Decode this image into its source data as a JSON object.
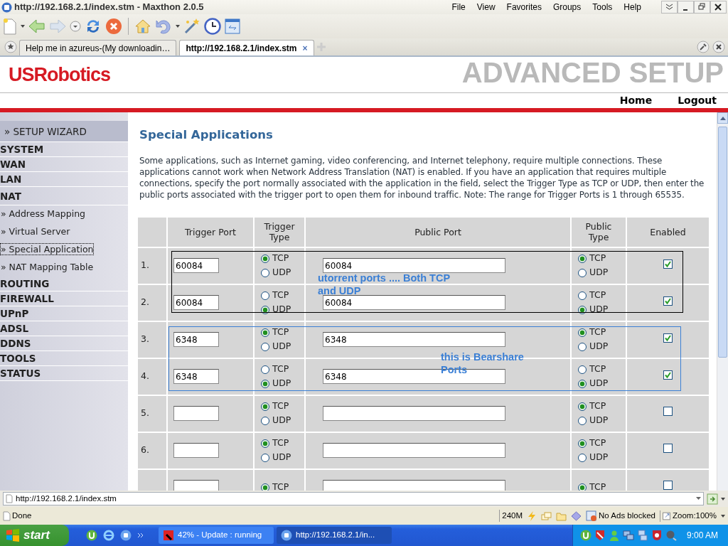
{
  "window": {
    "title": "http://192.168.2.1/index.stm - Maxthon 2.0.5"
  },
  "menu": [
    "File",
    "View",
    "Favorites",
    "Groups",
    "Tools",
    "Help"
  ],
  "tabs": [
    {
      "label": "Help me in azureus-(My downloadin…",
      "selected": false
    },
    {
      "label": "http://192.168.2.1/index.stm",
      "selected": true,
      "close": "×"
    }
  ],
  "router": {
    "logo": "USRobotics",
    "banner": "ADVANCED SETUP",
    "nav": [
      "Home",
      "Logout"
    ]
  },
  "sidebar": {
    "items": [
      {
        "label": "» SETUP WIZARD",
        "kind": "wizard",
        "selected": false
      },
      {
        "label": "SYSTEM",
        "kind": "section",
        "selected": false
      },
      {
        "label": "WAN",
        "kind": "section",
        "selected": false
      },
      {
        "label": "LAN",
        "kind": "section",
        "selected": false
      },
      {
        "label": "NAT",
        "kind": "section",
        "selected": false
      },
      {
        "label": "» Address Mapping",
        "kind": "sub",
        "selected": false
      },
      {
        "label": "» Virtual Server",
        "kind": "sub",
        "selected": false
      },
      {
        "label": "» Special Application",
        "kind": "sub",
        "selected": true
      },
      {
        "label": "» NAT Mapping Table",
        "kind": "sub",
        "selected": false
      },
      {
        "label": "ROUTING",
        "kind": "section",
        "selected": false
      },
      {
        "label": "FIREWALL",
        "kind": "section",
        "selected": false
      },
      {
        "label": "UPnP",
        "kind": "section",
        "selected": false
      },
      {
        "label": "ADSL",
        "kind": "section",
        "selected": false
      },
      {
        "label": "DDNS",
        "kind": "section",
        "selected": false
      },
      {
        "label": "TOOLS",
        "kind": "section",
        "selected": false
      },
      {
        "label": "STATUS",
        "kind": "section",
        "selected": false
      }
    ]
  },
  "content": {
    "title": "Special Applications",
    "intro": "Some applications, such as Internet gaming, video conferencing, and Internet telephony, require multiple connections. These applications cannot work when Network Address Translation (NAT) is enabled. If you have an application that requires multiple connections, specify the port normally associated with the application in the field, select the Trigger Type as TCP or UDP, then enter the public ports associated with the trigger port to open them for inbound traffic. Note: The range for Trigger Ports is 1 through 65535.",
    "columns": [
      "Trigger Port",
      "Trigger Type",
      "Public Port",
      "Public Type",
      "Enabled"
    ],
    "rows": [
      {
        "number": "1.",
        "trigger_port": "60084",
        "trigger_type": [
          {
            "label": "TCP",
            "selected": true
          },
          {
            "label": "UDP",
            "selected": false
          }
        ],
        "public_port": "60084",
        "public_type": [
          {
            "label": "TCP",
            "selected": true
          },
          {
            "label": "UDP",
            "selected": false
          }
        ],
        "enabled": true
      },
      {
        "number": "2.",
        "trigger_port": "60084",
        "trigger_type": [
          {
            "label": "TCP",
            "selected": false
          },
          {
            "label": "UDP",
            "selected": true
          }
        ],
        "public_port": "60084",
        "public_type": [
          {
            "label": "TCP",
            "selected": false
          },
          {
            "label": "UDP",
            "selected": true
          }
        ],
        "enabled": true
      },
      {
        "number": "3.",
        "trigger_port": "6348",
        "trigger_type": [
          {
            "label": "TCP",
            "selected": true
          },
          {
            "label": "UDP",
            "selected": false
          }
        ],
        "public_port": "6348",
        "public_type": [
          {
            "label": "TCP",
            "selected": true
          },
          {
            "label": "UDP",
            "selected": false
          }
        ],
        "enabled": true
      },
      {
        "number": "4.",
        "trigger_port": "6348",
        "trigger_type": [
          {
            "label": "TCP",
            "selected": false
          },
          {
            "label": "UDP",
            "selected": true
          }
        ],
        "public_port": "6348",
        "public_type": [
          {
            "label": "TCP",
            "selected": false
          },
          {
            "label": "UDP",
            "selected": true
          }
        ],
        "enabled": true
      },
      {
        "number": "5.",
        "trigger_type": [
          {
            "label": "TCP",
            "selected": true
          },
          {
            "label": "UDP",
            "selected": false
          }
        ],
        "public_type": [
          {
            "label": "TCP",
            "selected": true
          },
          {
            "label": "UDP",
            "selected": false
          }
        ],
        "enabled": false
      },
      {
        "number": "6.",
        "trigger_type": [
          {
            "label": "TCP",
            "selected": true
          },
          {
            "label": "UDP",
            "selected": false
          }
        ],
        "public_type": [
          {
            "label": "TCP",
            "selected": true
          },
          {
            "label": "UDP",
            "selected": false
          }
        ],
        "enabled": false
      },
      {
        "trigger_type": [
          {
            "label": "TCP",
            "selected": true
          }
        ],
        "public_type": [
          {
            "label": "TCP",
            "selected": true
          }
        ],
        "enabled": false
      }
    ],
    "annotations": [
      {
        "text": "utorrent ports .... Both TCP and UDP",
        "color": "#000000"
      },
      {
        "text": "this is Bearshare Ports",
        "color": "#3a7fd5"
      }
    ]
  },
  "address": {
    "url": "http://192.168.2.1/index.stm"
  },
  "status_bar": {
    "text": "Done",
    "memory": "240M",
    "ads": "No Ads blocked",
    "zoom": "Zoom:100%"
  },
  "taskbar": {
    "start": "start",
    "buttons": [
      {
        "label": "42% - Update : running",
        "selected": false
      },
      {
        "label": "http://192.168.2.1/in...",
        "selected": true
      }
    ],
    "clock": "9:00 AM"
  }
}
